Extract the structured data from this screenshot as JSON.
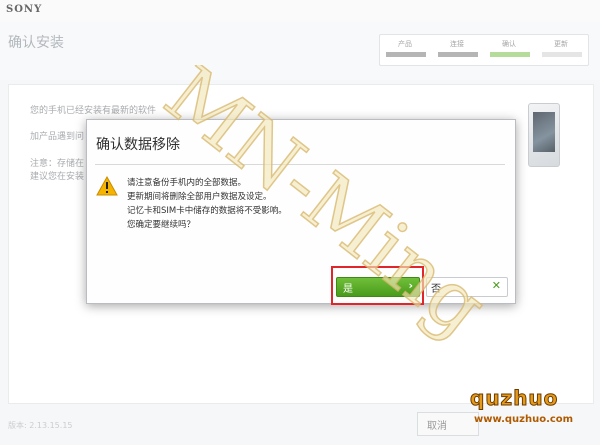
{
  "brand": "SONY",
  "page_title": "确认安装",
  "steps": [
    {
      "label": "产品",
      "state": "done"
    },
    {
      "label": "连接",
      "state": "done"
    },
    {
      "label": "确认",
      "state": "active"
    },
    {
      "label": "更新",
      "state": "pending"
    }
  ],
  "background_text": {
    "line1": "您的手机已经安装有最新的软件",
    "line2": "加产品遇到问",
    "line3": "注意：存储在",
    "line4": "建议您在安装"
  },
  "footer": {
    "version": "版本: 2.13.15.15",
    "cancel_label": "取消"
  },
  "dialog": {
    "title": "确认数据移除",
    "icon": "warning-icon",
    "message": [
      "请注意备份手机内的全部数据。",
      "更新期间将删除全部用户数据及设定。",
      "记忆卡和SIM卡中储存的数据将不受影响。",
      "您确定要继续吗？"
    ],
    "yes_label": "是",
    "no_label": "否"
  },
  "watermark": {
    "text": "MN-Ming",
    "logo_text": "quzhuo",
    "logo_url": "www.quzhuo.com"
  },
  "colors": {
    "accent_green": "#4a9a1c",
    "highlight_red": "#e0262b",
    "watermark_fill": "#f2e7b8",
    "watermark_stroke": "#d6b56a"
  }
}
